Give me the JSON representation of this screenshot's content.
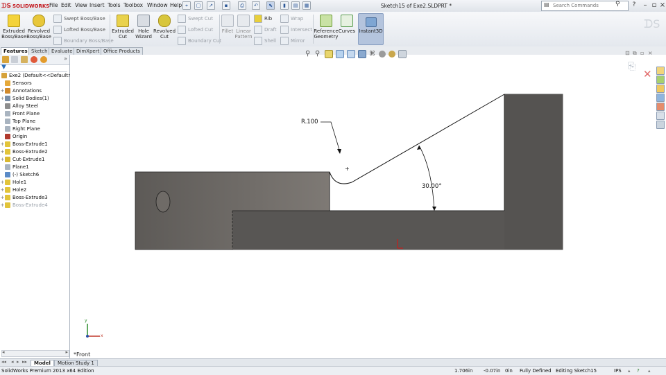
{
  "titlebar": {
    "logo": "SOLIDWORKS",
    "menus": [
      "File",
      "Edit",
      "View",
      "Insert",
      "Tools",
      "Toolbox",
      "Window",
      "Help"
    ],
    "document_title": "Sketch15 of Exe2.SLDPRT *",
    "search_placeholder": "Search Commands"
  },
  "commands": {
    "extruded_boss": "Extruded Boss/Base",
    "revolved_boss": "Revolved Boss/Base",
    "swept_boss": "Swept Boss/Base",
    "lofted_boss": "Lofted Boss/Base",
    "boundary_boss": "Boundary Boss/Base",
    "extruded_cut": "Extruded Cut",
    "hole_wizard": "Hole Wizard",
    "revolved_cut": "Revolved Cut",
    "swept_cut": "Swept Cut",
    "lofted_cut": "Lofted Cut",
    "boundary_cut": "Boundary Cut",
    "fillet": "Fillet",
    "linear_pattern": "Linear Pattern",
    "rib": "Rib",
    "draft": "Draft",
    "shell": "Shell",
    "wrap": "Wrap",
    "intersect": "Intersect",
    "mirror": "Mirror",
    "reference_geometry": "Reference Geometry",
    "curves": "Curves",
    "instant3d": "Instant3D"
  },
  "cm_tabs": [
    "Features",
    "Sketch",
    "Evaluate",
    "DimXpert",
    "Office Products"
  ],
  "tree": {
    "root": "Exe2  (Default<<Default>_",
    "items": [
      {
        "label": "Sensors",
        "icon": "sensor-icon",
        "exp": ""
      },
      {
        "label": "Annotations",
        "icon": "annotation-icon",
        "exp": "+"
      },
      {
        "label": "Solid Bodies(1)",
        "icon": "solid-bodies-icon",
        "exp": "+"
      },
      {
        "label": "Alloy Steel",
        "icon": "material-icon",
        "exp": ""
      },
      {
        "label": "Front Plane",
        "icon": "plane-icon",
        "exp": ""
      },
      {
        "label": "Top Plane",
        "icon": "plane-icon",
        "exp": ""
      },
      {
        "label": "Right Plane",
        "icon": "plane-icon",
        "exp": ""
      },
      {
        "label": "Origin",
        "icon": "origin-icon",
        "exp": ""
      },
      {
        "label": "Boss-Extrude1",
        "icon": "extrude-icon",
        "exp": "+"
      },
      {
        "label": "Boss-Extrude2",
        "icon": "extrude-icon",
        "exp": "+"
      },
      {
        "label": "Cut-Extrude1",
        "icon": "cut-icon",
        "exp": "+"
      },
      {
        "label": "Plane1",
        "icon": "plane-icon",
        "exp": ""
      },
      {
        "label": "(-) Sketch6",
        "icon": "sketch-icon",
        "exp": ""
      },
      {
        "label": "Hole1",
        "icon": "hole-icon",
        "exp": "+"
      },
      {
        "label": "Hole2",
        "icon": "hole-icon",
        "exp": "+"
      },
      {
        "label": "Boss-Extrude3",
        "icon": "extrude-icon",
        "exp": "+"
      },
      {
        "label": "Boss-Extrude4",
        "icon": "extrude-icon",
        "exp": "+",
        "dim": true
      }
    ]
  },
  "graphics": {
    "radius_label": "R.100",
    "angle_label": "30.00°",
    "view_name": "*Front",
    "triad": {
      "x": "x",
      "y": "y"
    }
  },
  "bottom_tabs": [
    "Model",
    "Motion Study 1"
  ],
  "status": {
    "product": "SolidWorks Premium 2013 x64 Edition",
    "x": "1.706in",
    "y": "-0.07in",
    "z": "0in",
    "definition": "Fully Defined",
    "editing": "Editing Sketch15",
    "units": "IPS"
  },
  "colors": {
    "part_face": "#5a5856",
    "part_highlight": "#8a8682",
    "instant3d_bg": "#b4c4dd",
    "brand_red": "#c4161c"
  }
}
